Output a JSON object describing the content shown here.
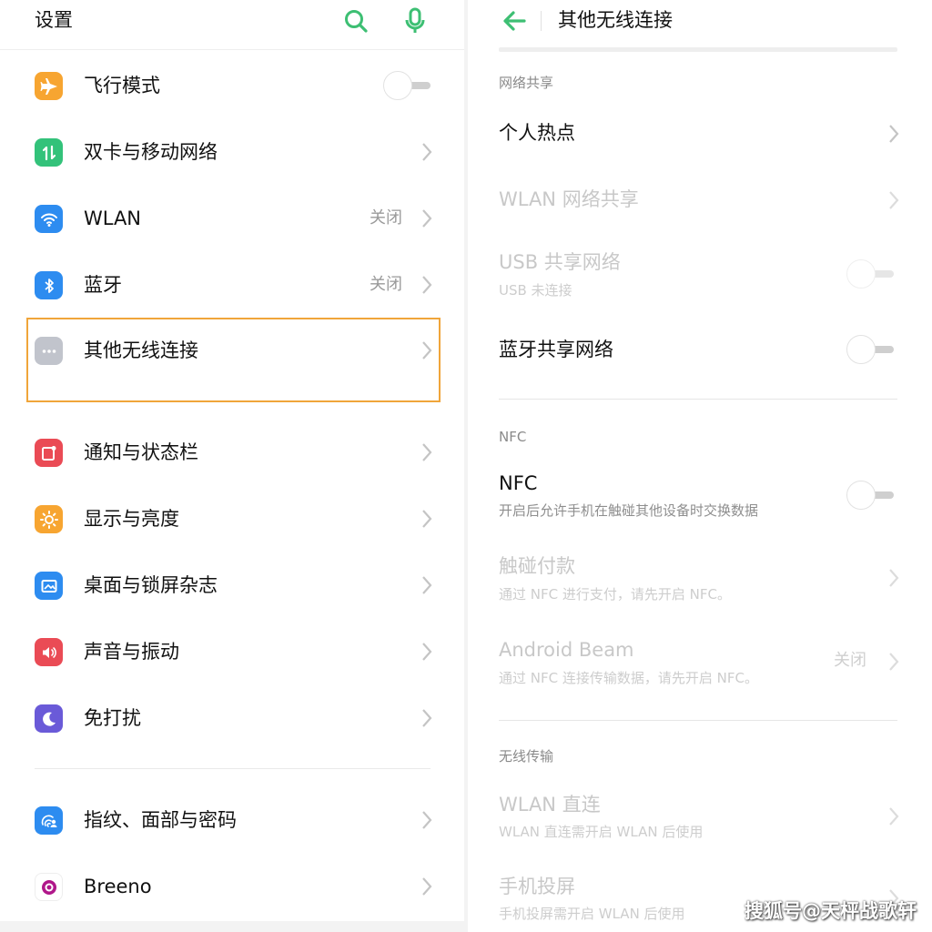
{
  "left": {
    "title": "设置",
    "items": [
      {
        "label": "飞行模式",
        "value": "",
        "icon": "airplane-icon",
        "color": "#f7a531"
      },
      {
        "label": "双卡与移动网络",
        "value": "",
        "icon": "sim-data-icon",
        "color": "#33c27a"
      },
      {
        "label": "WLAN",
        "value": "关闭",
        "icon": "wifi-icon",
        "color": "#2d8cf0"
      },
      {
        "label": "蓝牙",
        "value": "关闭",
        "icon": "bluetooth-icon",
        "color": "#2d8cf0"
      },
      {
        "label": "其他无线连接",
        "value": "",
        "icon": "more-dots-icon",
        "color": "#c1c4cc"
      },
      {
        "label": "通知与状态栏",
        "value": "",
        "icon": "notification-icon",
        "color": "#ea4b55"
      },
      {
        "label": "显示与亮度",
        "value": "",
        "icon": "brightness-icon",
        "color": "#f7a531"
      },
      {
        "label": "桌面与锁屏杂志",
        "value": "",
        "icon": "wallpaper-icon",
        "color": "#2d8cf0"
      },
      {
        "label": "声音与振动",
        "value": "",
        "icon": "sound-icon",
        "color": "#ea4b55"
      },
      {
        "label": "免打扰",
        "value": "",
        "icon": "moon-icon",
        "color": "#6a5ad8"
      },
      {
        "label": "指纹、面部与密码",
        "value": "",
        "icon": "fingerprint-icon",
        "color": "#2d8cf0"
      },
      {
        "label": "Breeno",
        "value": "",
        "icon": "breeno-icon",
        "color": "#b0178a"
      }
    ]
  },
  "right": {
    "title": "其他无线连接",
    "sections": {
      "tethering": "网络共享",
      "nfc": "NFC",
      "wireless_transfer": "无线传输"
    },
    "items": {
      "hotspot": {
        "title": "个人热点"
      },
      "wlan_share": {
        "title": "WLAN 网络共享"
      },
      "usb_share": {
        "title": "USB 共享网络",
        "subtitle": "USB 未连接"
      },
      "bt_share": {
        "title": "蓝牙共享网络"
      },
      "nfc": {
        "title": "NFC",
        "subtitle": "开启后允许手机在触碰其他设备时交换数据"
      },
      "tap_pay": {
        "title": "触碰付款",
        "subtitle": "通过 NFC 进行支付，请先开启 NFC。"
      },
      "beam": {
        "title": "Android Beam",
        "subtitle": "通过 NFC 连接传输数据，请先开启 NFC。",
        "value": "关闭"
      },
      "wlan_direct": {
        "title": "WLAN 直连",
        "subtitle": "WLAN 直连需开启 WLAN 后使用"
      },
      "screen_cast": {
        "title": "手机投屏",
        "subtitle": "手机投屏需开启 WLAN 后使用"
      }
    }
  },
  "watermark": "搜狐号@天枰战歌轩",
  "colors": {
    "accent": "#3dbf73",
    "highlight": "#f0a53a"
  }
}
